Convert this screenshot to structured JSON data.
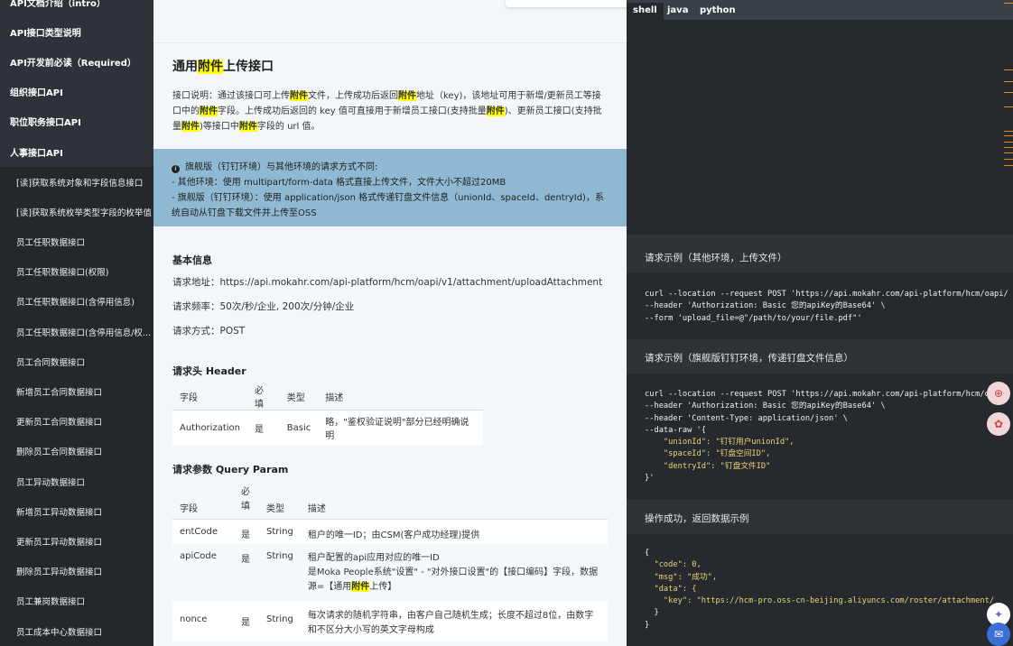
{
  "sidebar": {
    "top_items": [
      "API文档介绍（intro）",
      "API接口类型说明",
      "API开发前必读（Required）",
      "组织接口API",
      "职位职务接口API",
      "人事接口API"
    ],
    "sub_items": [
      "[读]获取系统对象和字段信息接口",
      "[读]获取系统枚举类型字段的枚举值",
      "员工任职数据接口",
      "员工任职数据接口(权限)",
      "员工任职数据接口(含停用信息)",
      "员工任职数据接口(含停用信息/权...",
      "员工合同数据接口",
      "新增员工合同数据接口",
      "更新员工合同数据接口",
      "删除员工合同数据接口",
      "员工异动数据接口",
      "新增员工异动数据接口",
      "更新员工异动数据接口",
      "删除员工异动数据接口",
      "员工兼岗数据接口",
      "员工成本中心数据接口"
    ]
  },
  "main": {
    "title_before": "通用",
    "title_highlight": "附件",
    "title_after": "上传接口",
    "desc_segments": [
      "接口说明：通过该接口可上传",
      "附件",
      "文件，上传成功后返回",
      "附件",
      "地址（key)，该地址可用于新增/更新员工等接口中的",
      "附件",
      "字段。上传成功后返回的 key 值可直接用于新增员工接口(支持批量",
      "附件",
      ")、更新员工接口(支持批量",
      "附件",
      ")等接口中",
      "附件",
      "字段的 url 值。"
    ],
    "notice_title": "旗舰版（钉钉环境）与其他环境的请求方式不同:",
    "notice_line1": "- 其他环境：使用 multipart/form-data 格式直接上传文件，文件大小不超过20MB",
    "notice_line2": "- 旗舰版（钉钉环境）：使用 application/json 格式传递钉盘文件信息（unionId、spaceId、dentryId)，系统自动从钉盘下载文件并上传至OSS",
    "basic_info_title": "基本信息",
    "request_url": "请求地址：https://api.mokahr.com/api-platform/hcm/oapi/v1/attachment/uploadAttachment",
    "request_rate": "请求频率：50次/秒/企业, 200次/分钟/企业",
    "request_method": "请求方式：POST",
    "header_title": "请求头 Header",
    "header_table": {
      "columns": [
        "字段",
        "必填",
        "类型",
        "描述"
      ],
      "rows": [
        [
          "Authorization",
          "是",
          "Basic",
          "略，\"鉴权验证说明\"部分已经明确说明"
        ]
      ]
    },
    "query_title": "请求参数 Query Param",
    "query_table": {
      "columns": [
        "字段",
        "必填",
        "类型",
        "描述"
      ],
      "rows": [
        [
          "entCode",
          "是",
          "String",
          "租户的唯一ID；由CSM(客户成功经理)提供"
        ],
        [
          "apiCode",
          "是",
          "String",
          "租户配置的api应用对应的唯一ID"
        ],
        [
          "nonce",
          "是",
          "String",
          "每次请求的随机字符串，由客户自己随机生成；长度不超过8位，由数字和不区分大小写的英文字母构成"
        ]
      ],
      "apicode_extra_before": "是Moka People系统\"设置\" - \"对外接口设置\"的【接口编码】字段，数据源=【通用",
      "apicode_extra_highlight": "附件",
      "apicode_extra_after": "上传】"
    }
  },
  "code": {
    "tabs": [
      "shell",
      "java",
      "python"
    ],
    "active_tab": "shell",
    "label1": "请求示例（其他环境，上传文件）",
    "code1": [
      "curl --location --request POST 'https://api.mokahr.com/api-platform/hcm/oapi/",
      "--header 'Authorization: Basic 您的apiKey的Base64' \\",
      "--form 'upload_file=@\"/path/to/your/file.pdf\"'"
    ],
    "label2": "请求示例（旗舰版钉钉环境，传递钉盘文件信息）",
    "code2": [
      "curl --location --request POST 'https://api.mokahr.com/api-platform/hcm/oapi/",
      "--header 'Authorization: Basic 您的apiKey的Base64' \\",
      "--header 'Content-Type: application/json' \\",
      "--data-raw '{",
      "    \"unionId\": \"钉钉用户unionId\",",
      "    \"spaceId\": \"钉盘空间ID\",",
      "    \"dentryId\": \"钉盘文件ID\"",
      "}'"
    ],
    "label3": "操作成功，返回数据示例",
    "code3": [
      "{",
      "  \"code\": 0,",
      "  \"msg\": \"成功\",",
      "  \"data\": {",
      "    \"key\": \"https://hcm-pro.oss-cn-beijing.aliyuncs.com/roster/attachment/",
      "  }",
      "}"
    ]
  },
  "colors": {
    "sidebar_bg": "#2f3339",
    "code_bg": "#262a2f",
    "notice_bg": "#8fb9d2",
    "highlight": "#ffff00"
  }
}
